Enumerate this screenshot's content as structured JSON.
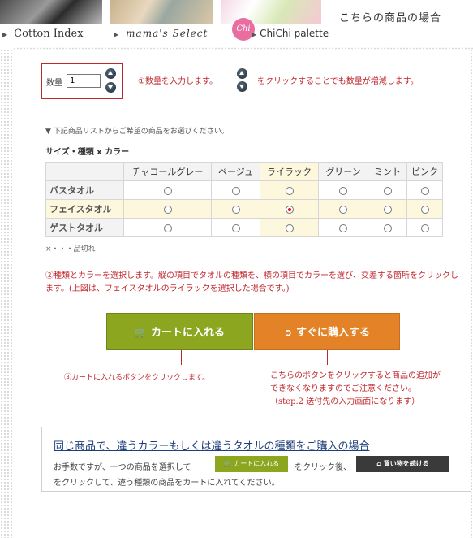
{
  "header": {
    "nav": [
      "Cotton Index",
      "mama's Select",
      "ChiChi palette"
    ],
    "chichi_logo_text": "Chi",
    "title": "こちらの商品の場合"
  },
  "quantity": {
    "label": "数量",
    "value": "1",
    "note_a": "①数量を入力します。",
    "note_b": "をクリックすることでも数量が増減します。"
  },
  "instruction": "▼ 下記商品リストからご希望の商品をお選びください。",
  "subheading": "サイズ・種類 x カラー",
  "table": {
    "columns": [
      "チャコールグレー",
      "ベージュ",
      "ライラック",
      "グリーン",
      "ミント",
      "ピンク"
    ],
    "rows": [
      "バスタオル",
      "フェイスタオル",
      "ゲストタオル"
    ],
    "selected_row": "フェイスタオル",
    "selected_column": "ライラック"
  },
  "soldout_note": "×・・・品切れ",
  "note2": "②種類とカラーを選択します。縦の項目でタオルの種類を、横の項目でカラーを選び、交差する箇所をクリックします。(上図は、フェイスタオルのライラックを選択した場合です。)",
  "buttons": {
    "cart": "カートに入れる",
    "buy_now": "すぐに購入する"
  },
  "note3": "③カートに入れるボタンをクリックします。",
  "note4": {
    "line1": "こちらのボタンをクリックすると商品の追加が",
    "line2": "できなくなりますのでご注意ください。",
    "line3": "（step.2 送付先の入力画面になります）"
  },
  "info": {
    "title": "同じ商品で、違うカラーもしくは違うタオルの種類をご購入の場合",
    "text1": "お手数ですが、一つの商品を選択して",
    "mini_cart": "カートに入れる",
    "text2": "をクリック後、",
    "mini_continue": "買い物を続ける",
    "text3": "をクリックして、違う種類の商品をカートに入れてください。"
  },
  "colors": {
    "accent_red": "#c0272d",
    "cart_green": "#8ca61f",
    "buy_orange": "#e48227",
    "highlight": "#fdf7dd",
    "link_blue": "#1f3f7a"
  }
}
